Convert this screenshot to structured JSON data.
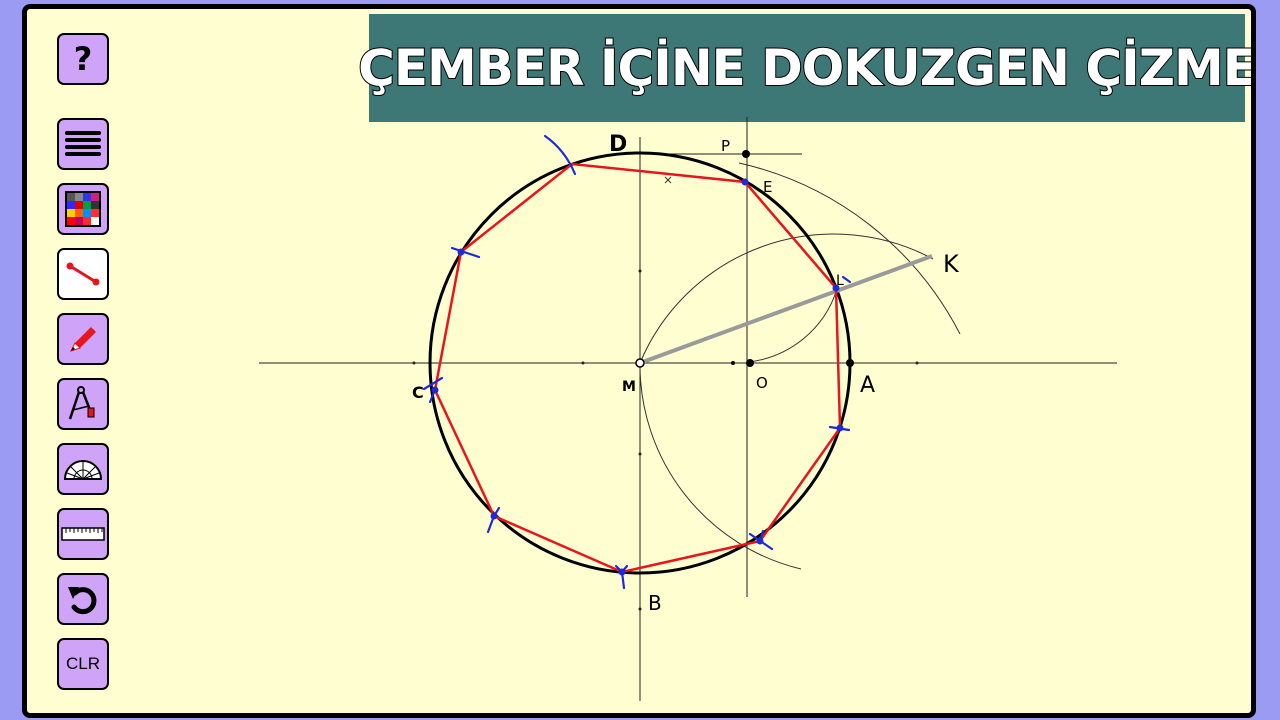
{
  "title": "ÇEMBER İÇİNE DOKUZGEN ÇİZME",
  "toolbar": {
    "help_label": "?",
    "clear_label": "CLR",
    "tools": [
      "help-icon",
      "menu-icon",
      "color-palette-icon",
      "line-tool-icon",
      "pencil-icon",
      "compass-icon",
      "protractor-icon",
      "ruler-icon",
      "undo-icon",
      "clear-button"
    ]
  },
  "labels": {
    "D": "D",
    "P": "P",
    "E": "E",
    "K": "K",
    "M": "M",
    "O": "O",
    "A": "A",
    "B": "B",
    "C": "C",
    "L": "L"
  },
  "colors": {
    "background": "#9b9bf3",
    "board": "#fefed0",
    "title_bar": "#3d7876",
    "tool_button": "#cfa3f8",
    "polygon": "#e8141e",
    "arc_marks": "#1e2ad8",
    "segment_MK": "#9a9a9a"
  }
}
